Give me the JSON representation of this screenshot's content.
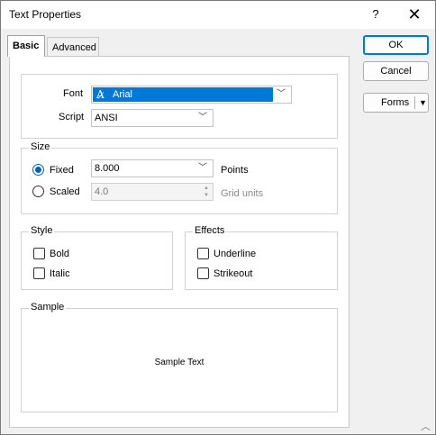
{
  "window": {
    "title": "Text Properties",
    "help_label": "?",
    "close_label": "✕"
  },
  "tabs": [
    {
      "label": "Basic",
      "active": true
    },
    {
      "label": "Advanced",
      "active": false
    }
  ],
  "font_group": {
    "font_label": "Font",
    "font_value": "Arial",
    "script_label": "Script",
    "script_value": "ANSI"
  },
  "size_group": {
    "legend": "Size",
    "fixed_label": "Fixed",
    "fixed_value": "8.000",
    "fixed_unit": "Points",
    "fixed_checked": true,
    "scaled_label": "Scaled",
    "scaled_value": "4.0",
    "scaled_unit": "Grid units",
    "scaled_checked": false
  },
  "style_group": {
    "legend": "Style",
    "bold_label": "Bold",
    "italic_label": "Italic"
  },
  "effects_group": {
    "legend": "Effects",
    "underline_label": "Underline",
    "strikeout_label": "Strikeout"
  },
  "sample_group": {
    "legend": "Sample",
    "text": "Sample Text"
  },
  "buttons": {
    "ok": "OK",
    "cancel": "Cancel",
    "forms": "Forms"
  },
  "colors": {
    "accent": "#0078d7",
    "selection_text": "#ffffff"
  }
}
